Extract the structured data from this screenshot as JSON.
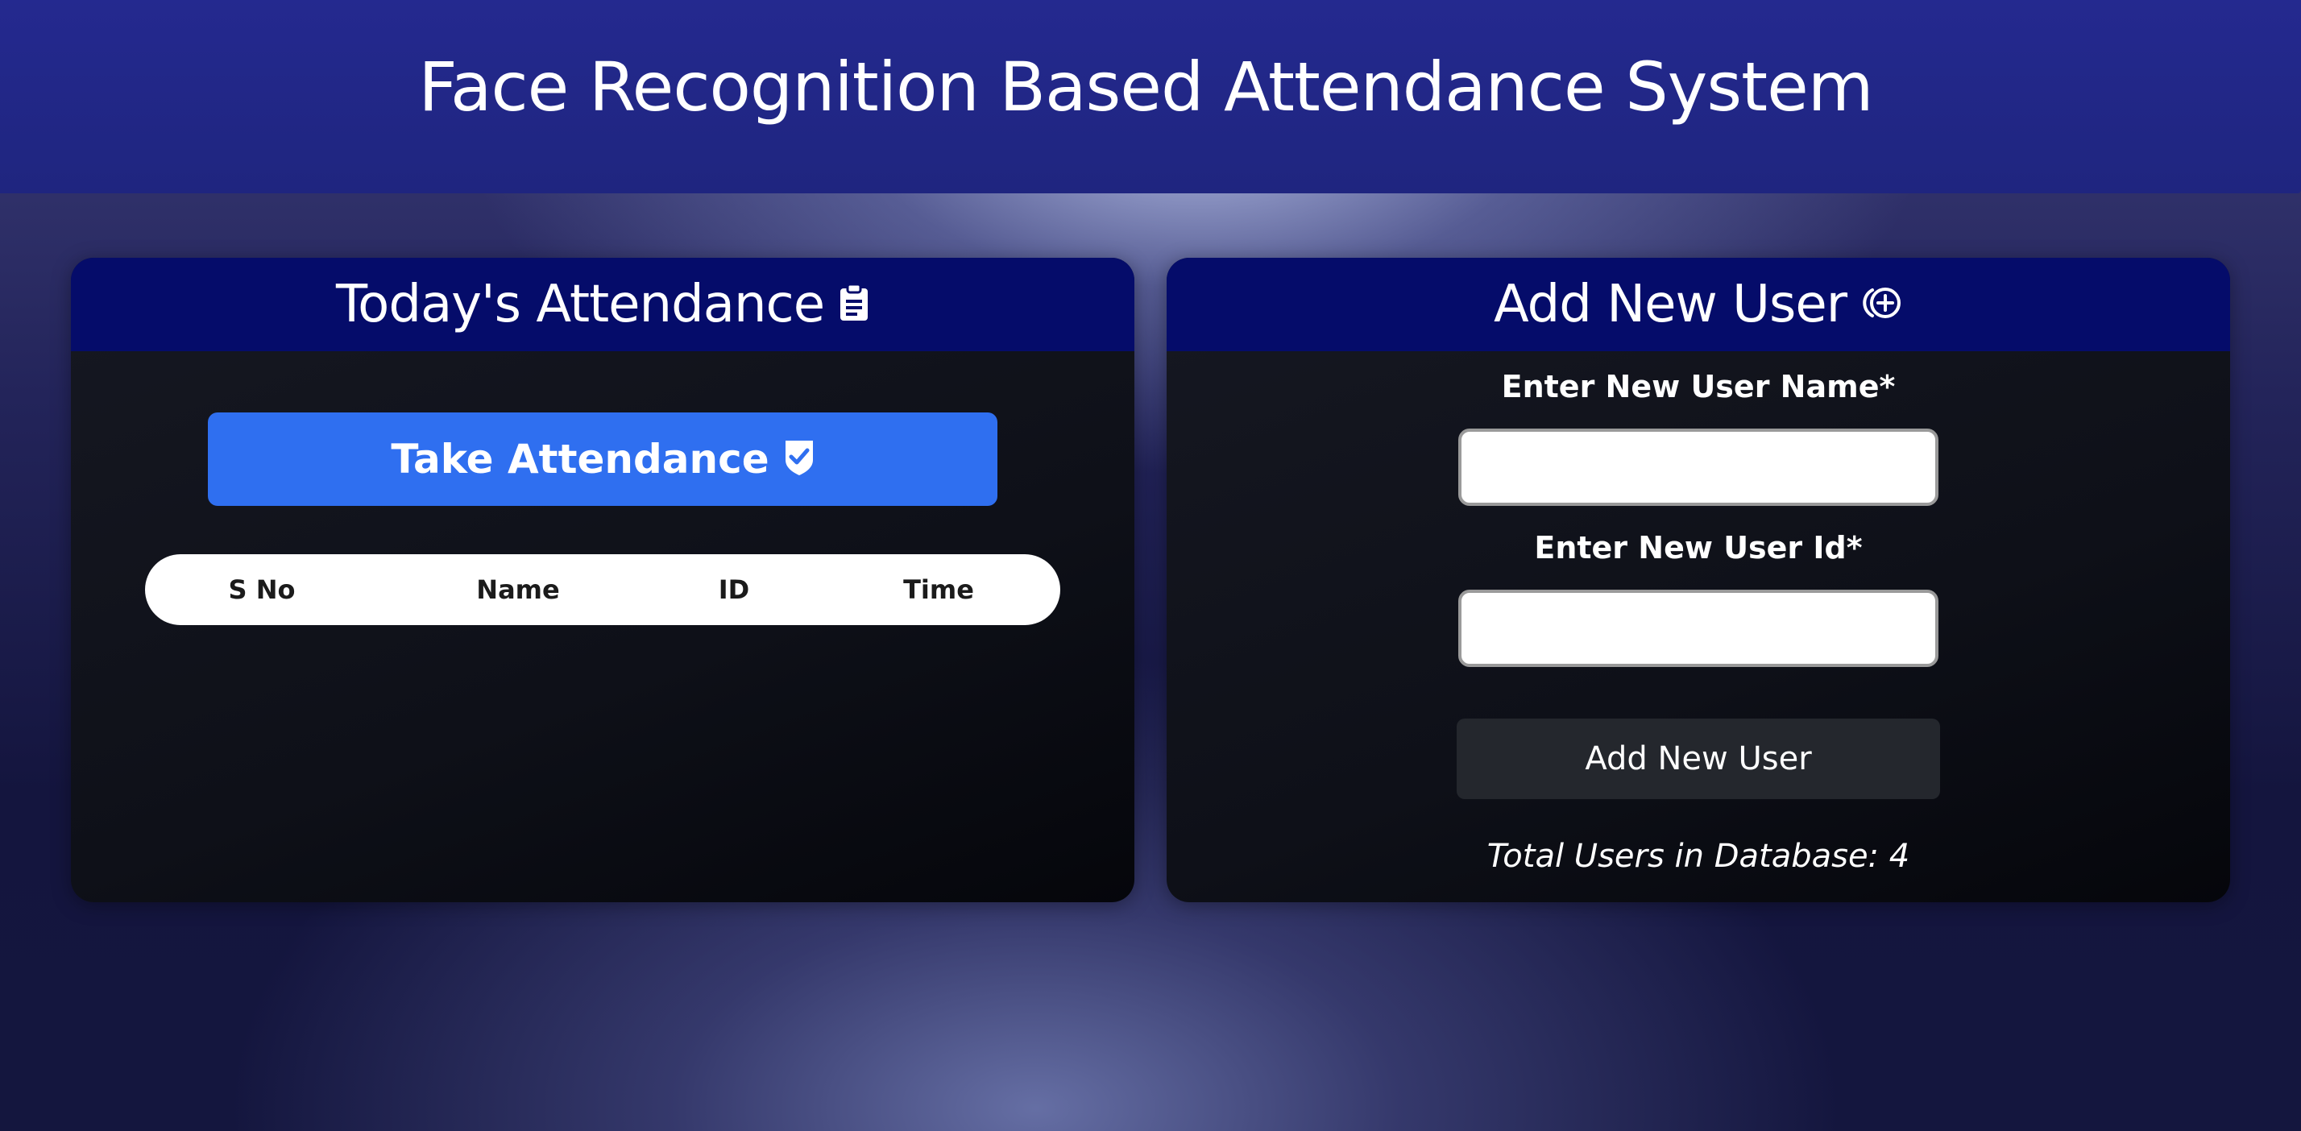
{
  "header": {
    "title": "Face Recognition Based Attendance System"
  },
  "attendance_panel": {
    "title": "Today's Attendance",
    "title_icon": "clipboard-icon",
    "take_button_label": "Take Attendance",
    "take_button_icon": "shield-check-icon",
    "table": {
      "columns": [
        "S No",
        "Name",
        "ID",
        "Time"
      ],
      "rows": []
    }
  },
  "add_user_panel": {
    "title": "Add New User",
    "title_icon": "circle-plus-icon",
    "name_label": "Enter New User Name*",
    "name_value": "",
    "id_label": "Enter New User Id*",
    "id_value": "",
    "submit_label": "Add New User",
    "total_users_text": "Total Users in Database: 4"
  },
  "colors": {
    "header_bg": "#24298f",
    "panel_header_bg": "#050c6a",
    "primary_button": "#2f6ff0",
    "secondary_button": "#24272d"
  }
}
